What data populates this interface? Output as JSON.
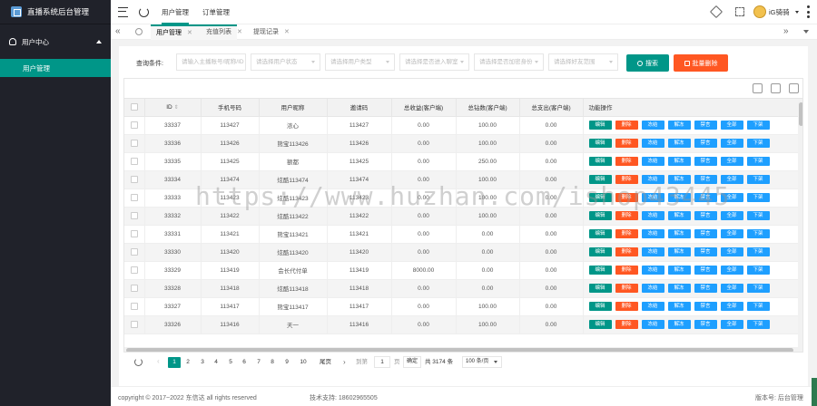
{
  "app": {
    "title": "直播系统后台管理"
  },
  "sidebar": {
    "group_label": "用户中心",
    "item_label": "用户管理"
  },
  "topbar": {
    "menu_tabs": [
      {
        "label": "用户管理"
      },
      {
        "label": "订单管理"
      }
    ],
    "username": "iG骑骑"
  },
  "tabs": [
    {
      "label": "用户管理"
    },
    {
      "label": "充值列表"
    },
    {
      "label": "提现记录"
    }
  ],
  "query": {
    "label": "查询条件:",
    "inputs": [
      {
        "placeholder": "请输入主播账号/昵称/ID"
      },
      {
        "placeholder": "请选择用户状态"
      },
      {
        "placeholder": "请选择用户类型"
      },
      {
        "placeholder": "请选择是否进入聊室"
      },
      {
        "placeholder": "请选择是否加密身份"
      },
      {
        "placeholder": "请选择好友范围"
      }
    ],
    "search_label": "搜索",
    "batch_delete_label": "批量删除"
  },
  "table": {
    "columns": [
      "ID",
      "手机号码",
      "用户昵称",
      "邀请码",
      "总收益(客户端)",
      "总钻数(客户端)",
      "总支出(客户端)",
      "功能操作"
    ],
    "actions": [
      "编辑",
      "删除",
      "冻结",
      "解冻",
      "禁言",
      "全部",
      "下架"
    ],
    "rows": [
      {
        "id": "33337",
        "phone": "113427",
        "nick": "浓心",
        "code": "113427",
        "income": "0.00",
        "diamonds": "100.00",
        "spend": "0.00"
      },
      {
        "id": "33336",
        "phone": "113426",
        "nick": "熊宝113426",
        "code": "113426",
        "income": "0.00",
        "diamonds": "100.00",
        "spend": "0.00"
      },
      {
        "id": "33335",
        "phone": "113425",
        "nick": "额都",
        "code": "113425",
        "income": "0.00",
        "diamonds": "250.00",
        "spend": "0.00"
      },
      {
        "id": "33334",
        "phone": "113474",
        "nick": "炫酷113474",
        "code": "113474",
        "income": "0.00",
        "diamonds": "100.00",
        "spend": "0.00"
      },
      {
        "id": "33333",
        "phone": "113423",
        "nick": "炫酷113423",
        "code": "113423",
        "income": "0.00",
        "diamonds": "100.00",
        "spend": "0.00"
      },
      {
        "id": "33332",
        "phone": "113422",
        "nick": "炫酷113422",
        "code": "113422",
        "income": "0.00",
        "diamonds": "100.00",
        "spend": "0.00"
      },
      {
        "id": "33331",
        "phone": "113421",
        "nick": "熊宝113421",
        "code": "113421",
        "income": "0.00",
        "diamonds": "0.00",
        "spend": "0.00"
      },
      {
        "id": "33330",
        "phone": "113420",
        "nick": "炫酷113420",
        "code": "113420",
        "income": "0.00",
        "diamonds": "0.00",
        "spend": "0.00"
      },
      {
        "id": "33329",
        "phone": "113419",
        "nick": "会长代付单",
        "code": "113419",
        "income": "8000.00",
        "diamonds": "0.00",
        "spend": "0.00"
      },
      {
        "id": "33328",
        "phone": "113418",
        "nick": "炫酷113418",
        "code": "113418",
        "income": "0.00",
        "diamonds": "0.00",
        "spend": "0.00"
      },
      {
        "id": "33327",
        "phone": "113417",
        "nick": "熊宝113417",
        "code": "113417",
        "income": "0.00",
        "diamonds": "100.00",
        "spend": "0.00"
      },
      {
        "id": "33326",
        "phone": "113416",
        "nick": "天一",
        "code": "113416",
        "income": "0.00",
        "diamonds": "100.00",
        "spend": "0.00"
      }
    ]
  },
  "pager": {
    "pages": [
      "1",
      "2",
      "3",
      "4",
      "5",
      "6",
      "7",
      "8",
      "9",
      "10"
    ],
    "current": "1",
    "last_label": "尾页",
    "goto_label": "到第",
    "goto_value": "1",
    "page_unit": "页",
    "confirm_label": "确定",
    "total": "共 3174 条",
    "per_page": "100 条/页"
  },
  "footer": {
    "copyright": "copyright © 2017~2022 东信达 all rights reserved",
    "support": "技术支持: 18602965505",
    "version": "版本号: 后台管理"
  },
  "watermark": "https://www.huzhan.com/ishop43445"
}
